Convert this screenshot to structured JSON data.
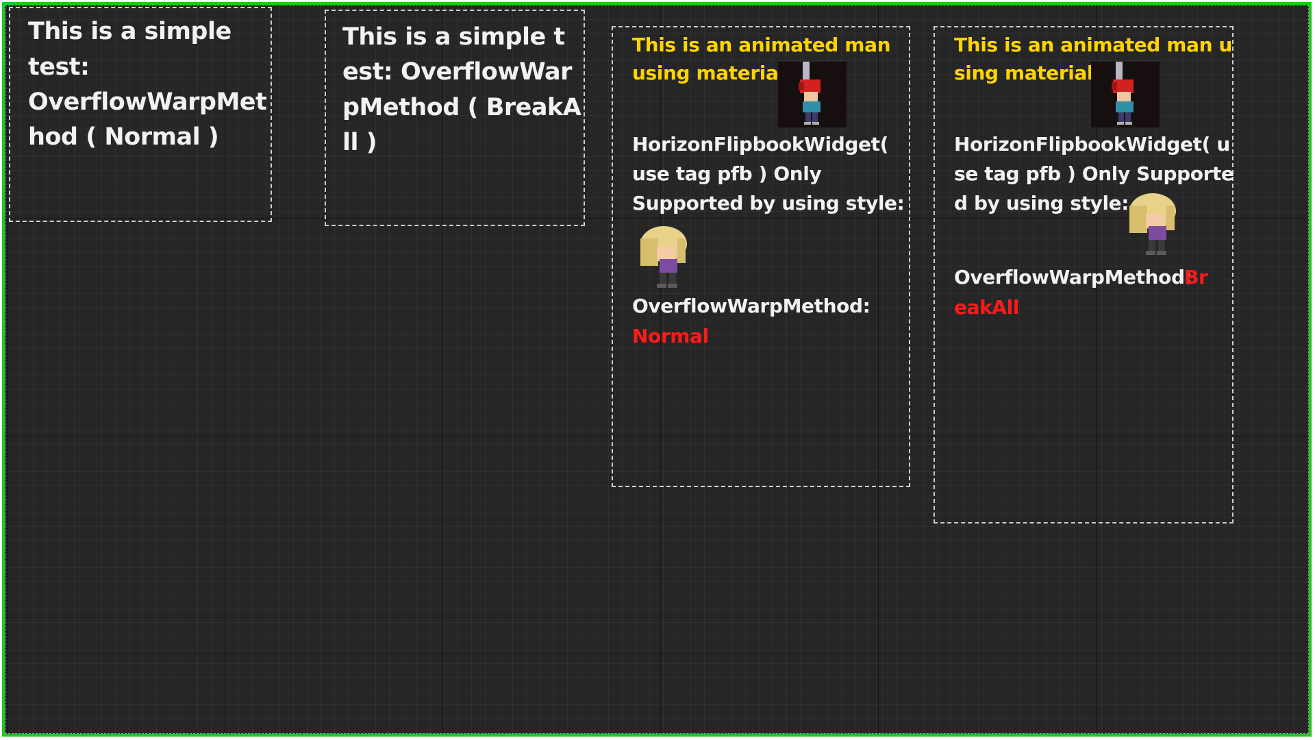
{
  "colors": {
    "frame_border": "#1ec81e",
    "canvas_bg": "#262626",
    "text_white": "#f2f2f2",
    "text_yellow": "#ffd400",
    "text_red": "#ff1a1a"
  },
  "panels": [
    {
      "lines": [
        "This is a simple",
        "test:",
        "OverflowWarpMet",
        "hod ( Normal )"
      ]
    },
    {
      "lines": [
        "This is a simple t",
        "est: OverflowWar",
        "pMethod ( BreakA",
        "ll )"
      ]
    },
    {
      "yellow_lines": [
        "This is an animated man",
        "using material:"
      ],
      "white_lines": [
        "HorizonFlipbookWidget(",
        "use tag pfb ) Only",
        "Supported by using style:"
      ],
      "method_label": "OverflowWarpMethod:",
      "method_value": "Normal",
      "icons": [
        "animated-man-sprite-icon",
        "blonde-girl-sprite-icon"
      ]
    },
    {
      "yellow_lines": [
        "This is an animated man u",
        "sing material:"
      ],
      "white_lines": [
        "HorizonFlipbookWidget( u",
        "se tag pfb ) Only Supporte",
        "d by using style:"
      ],
      "method_label": "OverflowWarpMethod:",
      "method_value_part1": "Br",
      "method_value_part2": "eakAll",
      "icons": [
        "animated-man-sprite-icon",
        "blonde-girl-sprite-icon"
      ]
    }
  ]
}
